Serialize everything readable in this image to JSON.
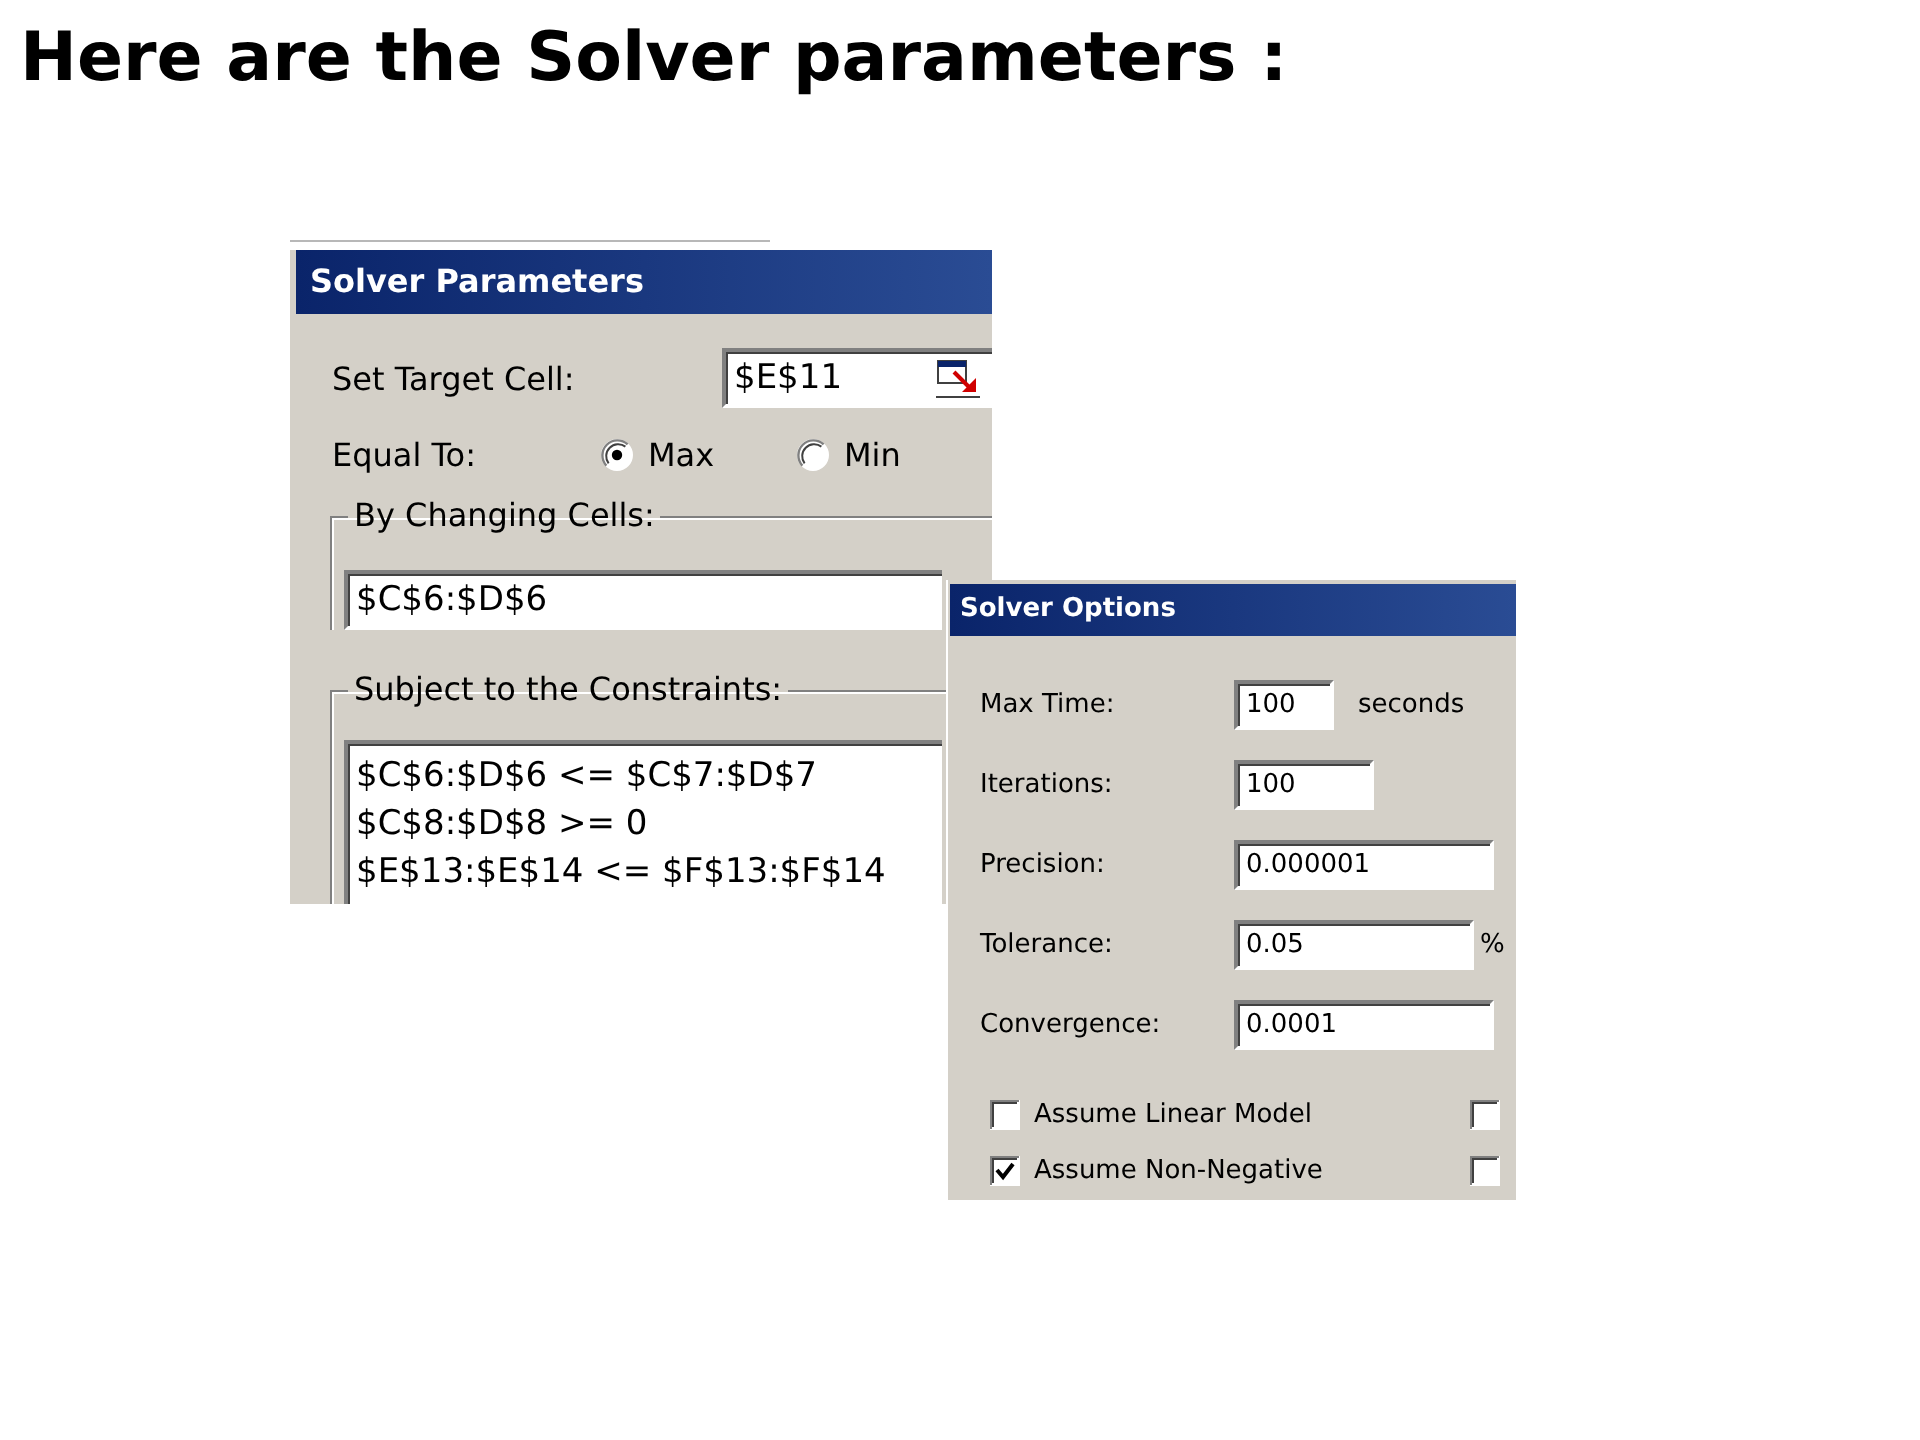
{
  "heading": "Here are the Solver parameters :",
  "solver_parameters": {
    "title": "Solver Parameters",
    "target_cell": {
      "label": "Set Target Cell:",
      "value": "$E$11"
    },
    "equal_to": {
      "label": "Equal To:",
      "options": [
        {
          "label": "Max",
          "selected": true
        },
        {
          "label": "Min",
          "selected": false
        }
      ]
    },
    "changing_cells": {
      "label": "By Changing Cells:",
      "value": "$C$6:$D$6"
    },
    "constraints": {
      "label": "Subject to the Constraints:",
      "items": [
        "$C$6:$D$6 <= $C$7:$D$7",
        "$C$8:$D$8 >= 0",
        "$E$13:$E$14 <= $F$13:$F$14"
      ]
    }
  },
  "solver_options": {
    "title": "Solver Options",
    "fields": [
      {
        "label": "Max Time:",
        "value": "100",
        "unit": "seconds"
      },
      {
        "label": "Iterations:",
        "value": "100"
      },
      {
        "label": "Precision:",
        "value": "0.000001"
      },
      {
        "label": "Tolerance:",
        "value": "0.05",
        "unit": "%"
      },
      {
        "label": "Convergence:",
        "value": "0.0001"
      }
    ],
    "checkbox_rows": [
      {
        "label": "Assume Linear Model",
        "checked": false,
        "right_checked": false
      },
      {
        "label": "Assume Non-Negative",
        "checked": true,
        "right_checked": false
      }
    ]
  }
}
